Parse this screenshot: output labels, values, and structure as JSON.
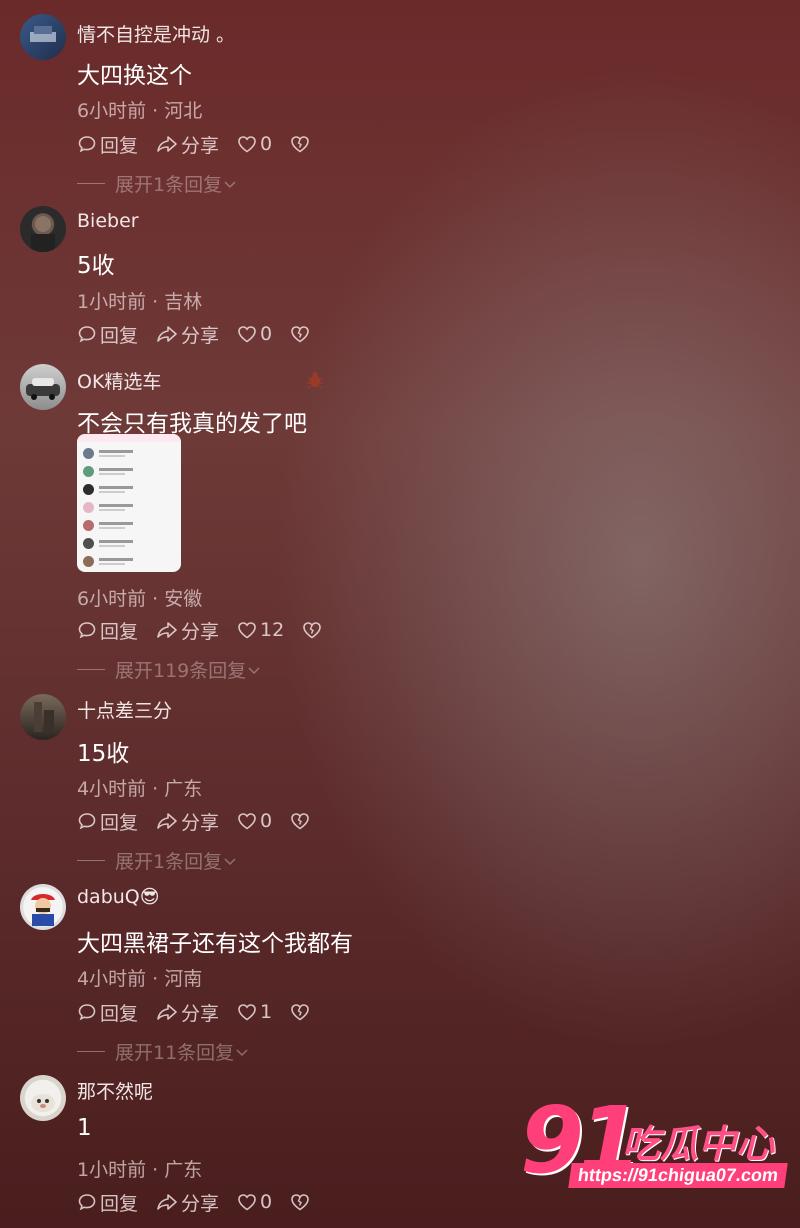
{
  "comments": [
    {
      "username": "情不自控是冲动 。",
      "content": "大四换这个",
      "time": "6小时前",
      "location": "河北",
      "reply_label": "回复",
      "share_label": "分享",
      "likes": "0",
      "expand": "展开1条回复"
    },
    {
      "username": "Bieber",
      "content": "5收",
      "time": "1小时前",
      "location": "吉林",
      "reply_label": "回复",
      "share_label": "分享",
      "likes": "0"
    },
    {
      "username": "OK精选车",
      "content": "不会只有我真的发了吧",
      "time": "6小时前",
      "location": "安徽",
      "reply_label": "回复",
      "share_label": "分享",
      "likes": "12",
      "expand": "展开119条回复"
    },
    {
      "username": "十点差三分",
      "content": "15收",
      "time": "4小时前",
      "location": "广东",
      "reply_label": "回复",
      "share_label": "分享",
      "likes": "0",
      "expand": "展开1条回复"
    },
    {
      "username": "dabuQ😎",
      "content": "大四黑裙子还有这个我都有",
      "time": "4小时前",
      "location": "河南",
      "reply_label": "回复",
      "share_label": "分享",
      "likes": "1",
      "expand": "展开11条回复"
    },
    {
      "username": "那不然呢",
      "content": "1",
      "time": "1小时前",
      "location": "广东",
      "reply_label": "回复",
      "share_label": "分享",
      "likes": "0"
    }
  ],
  "meta_separator": "·",
  "watermark": {
    "number": "91",
    "name": "吃瓜中心",
    "url": "https://91chigua07.com"
  },
  "colors": {
    "accent": "#ff3f7a"
  }
}
